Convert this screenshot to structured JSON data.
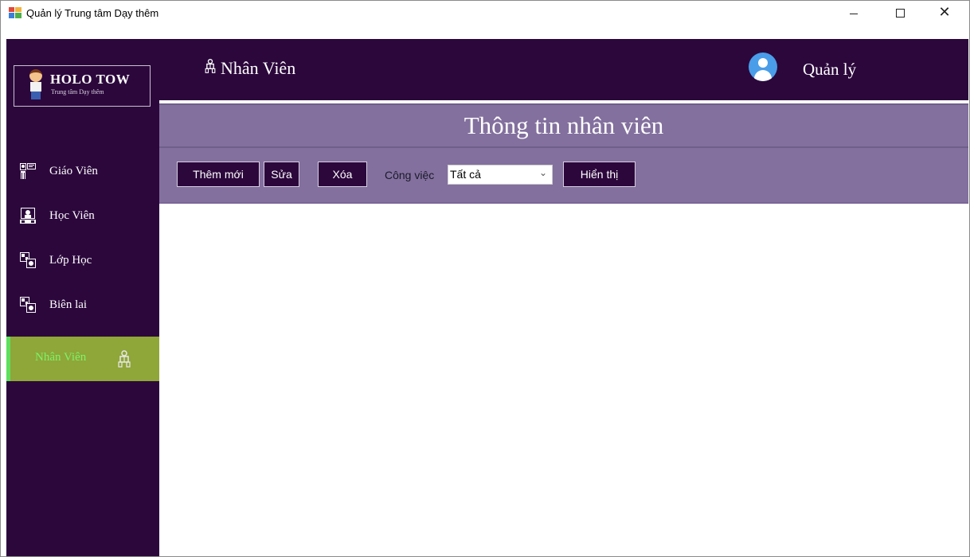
{
  "window": {
    "title": "Quản lý Trung tâm Dạy thêm",
    "icon": "app-grid-icon"
  },
  "logo": {
    "title": "HOLO TOW",
    "subtitle": "Trung tâm Dạy thêm"
  },
  "sidebar": {
    "items": [
      {
        "label": "Giáo Viên",
        "icon": "teacher-icon",
        "active": false
      },
      {
        "label": "Học Viên",
        "icon": "student-icon",
        "active": false
      },
      {
        "label": "Lớp Học",
        "icon": "classroom-icon",
        "active": false
      },
      {
        "label": "Biên lai",
        "icon": "receipt-icon",
        "active": false
      },
      {
        "label": "Nhân Viên",
        "icon": "staff-icon",
        "active": true
      }
    ]
  },
  "header": {
    "title": "Nhân Viên",
    "icon": "staff-icon",
    "user_role": "Quản lý",
    "avatar_icon": "user-avatar-icon"
  },
  "section": {
    "title": "Thông tin nhân viên"
  },
  "toolbar": {
    "add_label": "Thêm mới",
    "edit_label": "Sửa",
    "delete_label": "Xóa",
    "job_label": "Công việc",
    "job_value": "Tất cả",
    "show_label": "Hiển thị"
  },
  "colors": {
    "sidebar_bg": "#2c073c",
    "section_bg": "#83709e",
    "active_item_bg": "#8fa638",
    "active_text": "#7cf36a",
    "avatar": "#4a9de8"
  }
}
